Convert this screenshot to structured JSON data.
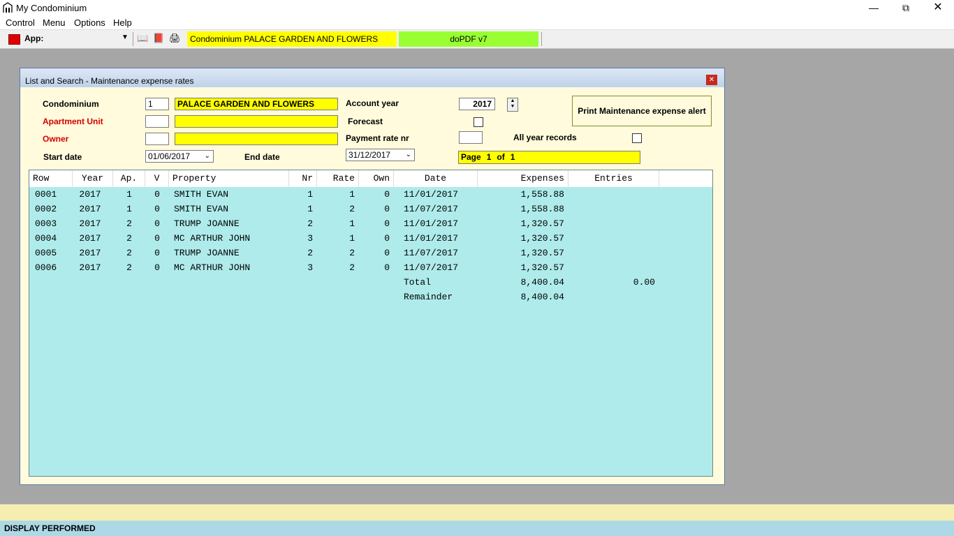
{
  "window": {
    "title": "My Condominium"
  },
  "menu": [
    "Control",
    "Menu",
    "Options",
    "Help"
  ],
  "toolbar": {
    "app_label": "App:",
    "condo_banner": "Condominium PALACE GARDEN AND FLOWERS",
    "pdf_banner": "doPDF v7"
  },
  "dialog": {
    "title": "List and Search - Maintenance expense rates",
    "condominium_label": "Condominium",
    "condominium_code": "1",
    "condominium_name": "PALACE GARDEN AND FLOWERS",
    "apartment_label": "Apartment Unit",
    "apartment_code": "",
    "apartment_name": "",
    "owner_label": "Owner",
    "owner_code": "",
    "owner_name": "",
    "start_date_label": "Start date",
    "start_date": "01/06/2017",
    "end_date_label": "End date",
    "end_date": "31/12/2017",
    "account_year_label": "Account year",
    "account_year": "2017",
    "forecast_label": "Forecast",
    "payment_rate_label": "Payment rate nr",
    "payment_rate": "",
    "all_year_label": "All year records",
    "print_alert": "Print Maintenance expense alert",
    "page": {
      "label": "Page",
      "current": "1",
      "of": "of",
      "total": "1"
    }
  },
  "grid": {
    "columns": [
      "Row",
      "Year",
      "Ap.",
      "V",
      "Property",
      "Nr",
      "Rate",
      "Own",
      "Date",
      "Expenses",
      "Entries"
    ],
    "rows": [
      [
        "0001",
        "2017",
        "1",
        "0",
        "SMITH EVAN",
        "1",
        "1",
        "0",
        "11/01/2017",
        "1,558.88"
      ],
      [
        "0002",
        "2017",
        "1",
        "0",
        "SMITH EVAN",
        "1",
        "2",
        "0",
        "11/07/2017",
        "1,558.88"
      ],
      [
        "0003",
        "2017",
        "2",
        "0",
        "TRUMP JOANNE",
        "2",
        "1",
        "0",
        "11/01/2017",
        "1,320.57"
      ],
      [
        "0004",
        "2017",
        "2",
        "0",
        "MC ARTHUR JOHN",
        "3",
        "1",
        "0",
        "11/01/2017",
        "1,320.57"
      ],
      [
        "0005",
        "2017",
        "2",
        "0",
        "TRUMP JOANNE",
        "2",
        "2",
        "0",
        "11/07/2017",
        "1,320.57"
      ],
      [
        "0006",
        "2017",
        "2",
        "0",
        "MC ARTHUR JOHN",
        "3",
        "2",
        "0",
        "11/07/2017",
        "1,320.57"
      ]
    ],
    "total_label": "Total",
    "total_expenses": "8,400.04",
    "total_entries": "0.00",
    "remainder_label": "Remainder",
    "remainder_expenses": "8,400.04"
  },
  "status": {
    "text": "DISPLAY PERFORMED"
  }
}
